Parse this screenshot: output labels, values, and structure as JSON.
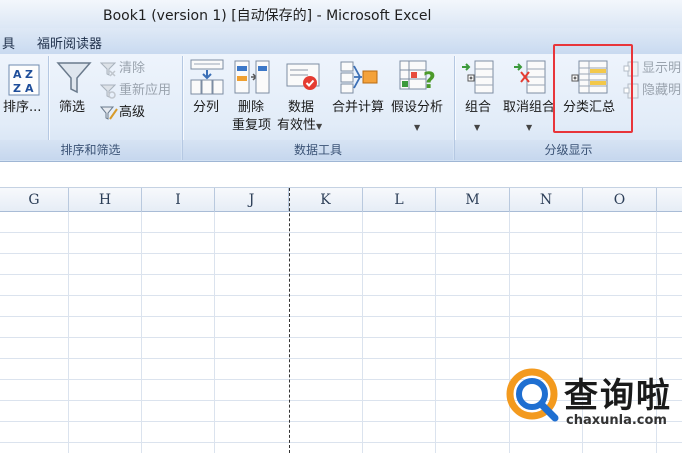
{
  "window": {
    "title": "Book1 (version 1) [自动保存的] - Microsoft Excel"
  },
  "tabs": [
    {
      "label": "具"
    },
    {
      "label": "福昕阅读器"
    }
  ],
  "ribbon": {
    "sort_filter": {
      "sort_label": "排序...",
      "filter_label": "筛选",
      "clear_label": "清除",
      "reapply_label": "重新应用",
      "advanced_label": "高级",
      "group_label": "排序和筛选"
    },
    "data_tools": {
      "text_to_columns_label": "分列",
      "remove_duplicates_label_1": "删除",
      "remove_duplicates_label_2": "重复项",
      "validation_label_1": "数据",
      "validation_label_2": "有效性",
      "consolidate_label": "合并计算",
      "what_if_label": "假设分析",
      "group_label": "数据工具"
    },
    "outline": {
      "group_label_btn": "组合",
      "ungroup_label": "取消组合",
      "subtotal_label": "分类汇总",
      "show_detail_label": "显示明",
      "hide_detail_label": "隐藏明",
      "group_label": "分级显示"
    }
  },
  "grid": {
    "columns": [
      "G",
      "H",
      "I",
      "J",
      "K",
      "L",
      "M",
      "N",
      "O"
    ]
  },
  "watermark": {
    "brand": "查询啦",
    "domain": "chaxunla.com"
  },
  "colors": {
    "highlight_border": "#e8353a",
    "ribbon_bg": "#e2ecf8",
    "watermark_orange": "#f39a1e",
    "watermark_blue": "#1f6fd1"
  }
}
